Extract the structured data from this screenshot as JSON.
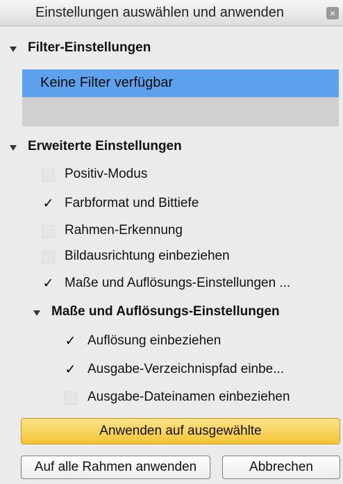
{
  "window": {
    "title": "Einstellungen auswählen und anwenden",
    "close_glyph": "×"
  },
  "filter_section": {
    "heading": "Filter-Einstellungen",
    "items": [
      "Keine Filter verfügbar"
    ]
  },
  "advanced_section": {
    "heading": "Erweiterte Einstellungen",
    "options": [
      {
        "label": "Positiv-Modus",
        "checked": false
      },
      {
        "label": "Farbformat und Bittiefe",
        "checked": true
      },
      {
        "label": "Rahmen-Erkennung",
        "checked": false
      },
      {
        "label": "Bildausrichtung einbeziehen",
        "checked": false
      },
      {
        "label": "Maße und Auflösungs-Einstellungen ...",
        "checked": true
      }
    ]
  },
  "dimensions_section": {
    "heading": "Maße und Auflösungs-Einstellungen",
    "options": [
      {
        "label": "Auflösung einbeziehen",
        "checked": true
      },
      {
        "label": "Ausgabe-Verzeichnispfad einbe...",
        "checked": true
      },
      {
        "label": "Ausgabe-Dateinamen einbeziehen",
        "checked": false
      }
    ]
  },
  "buttons": {
    "apply_selected": "Anwenden auf ausgewählte",
    "apply_all": "Auf alle Rahmen anwenden",
    "cancel": "Abbrechen"
  },
  "colors": {
    "selection": "#5ea2ee",
    "primary_button": "#f4c534"
  }
}
